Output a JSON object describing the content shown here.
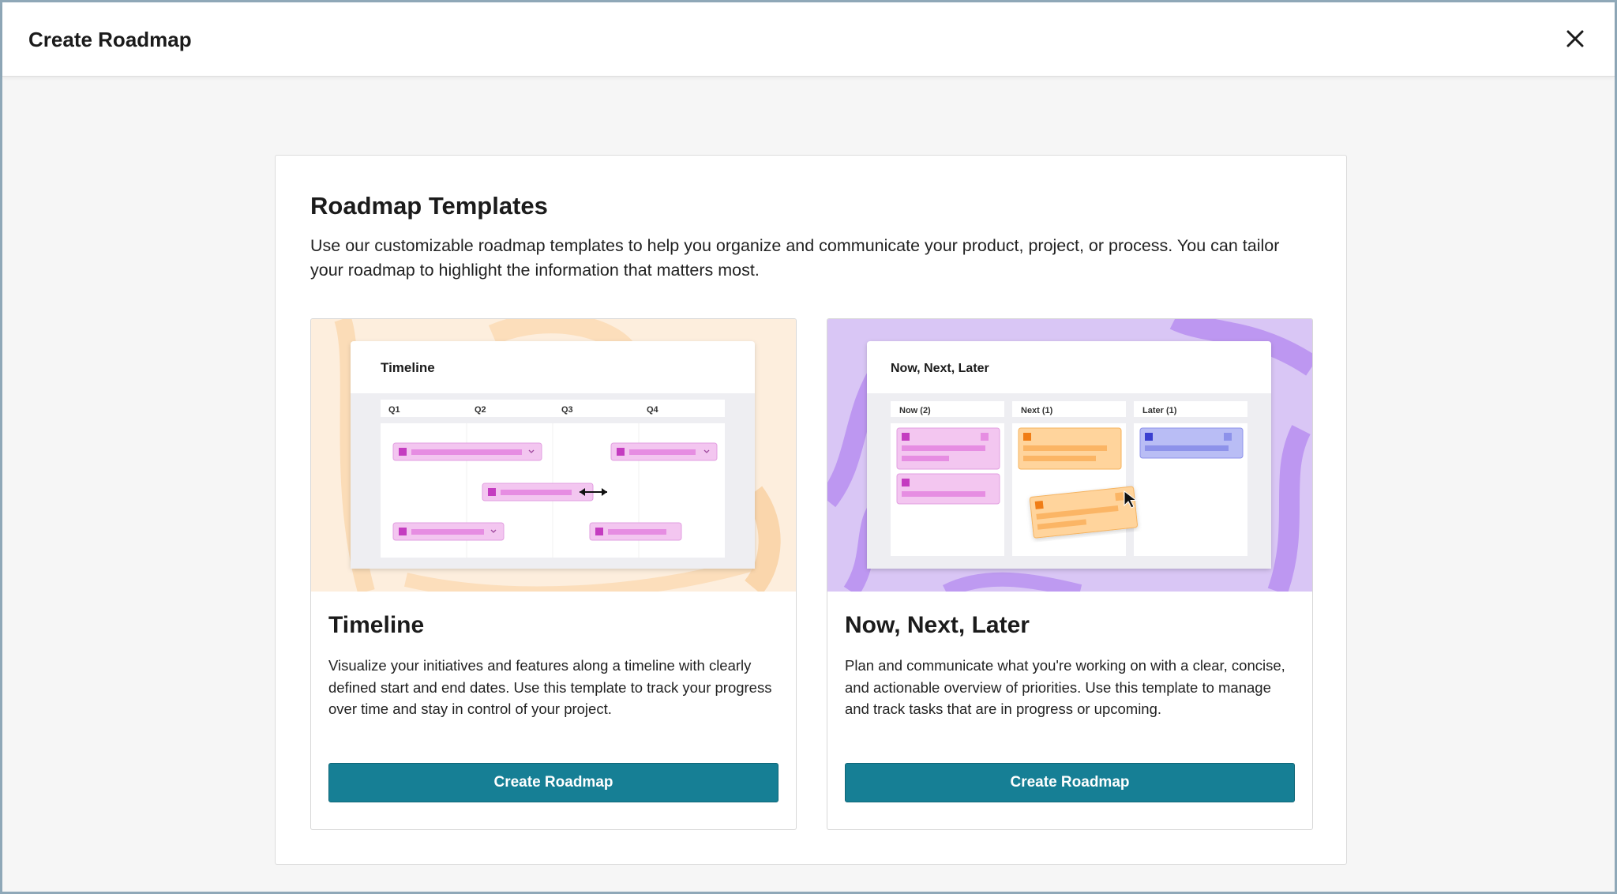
{
  "header": {
    "title": "Create Roadmap"
  },
  "panel": {
    "title": "Roadmap Templates",
    "description": "Use our customizable roadmap templates to help you organize and communicate your product, project, or process. You can tailor your roadmap to highlight the information that matters most."
  },
  "cards": [
    {
      "title": "Timeline",
      "description": "Visualize your initiatives and features along a timeline with clearly defined start and end dates. Use this template to track your progress over time and stay in control of your project.",
      "button_label": "Create Roadmap",
      "preview": {
        "title": "Timeline",
        "columns": [
          "Q1",
          "Q2",
          "Q3",
          "Q4"
        ]
      }
    },
    {
      "title": "Now, Next, Later",
      "description": "Plan and communicate what you're working on with a clear, concise, and actionable overview of priorities. Use this template to manage and track tasks that are in progress or upcoming.",
      "button_label": "Create Roadmap",
      "preview": {
        "title": "Now, Next, Later",
        "columns": [
          "Now (2)",
          "Next (1)",
          "Later (1)"
        ]
      }
    }
  ],
  "colors": {
    "primary_button": "#167f95",
    "timeline_bg": "#fdeedd",
    "nnl_bg": "#d9c6f5",
    "pink": "#f3c6f0",
    "orange": "#ffd49c",
    "blue": "#b9bdf5"
  },
  "icons": {
    "close": "close-icon"
  }
}
